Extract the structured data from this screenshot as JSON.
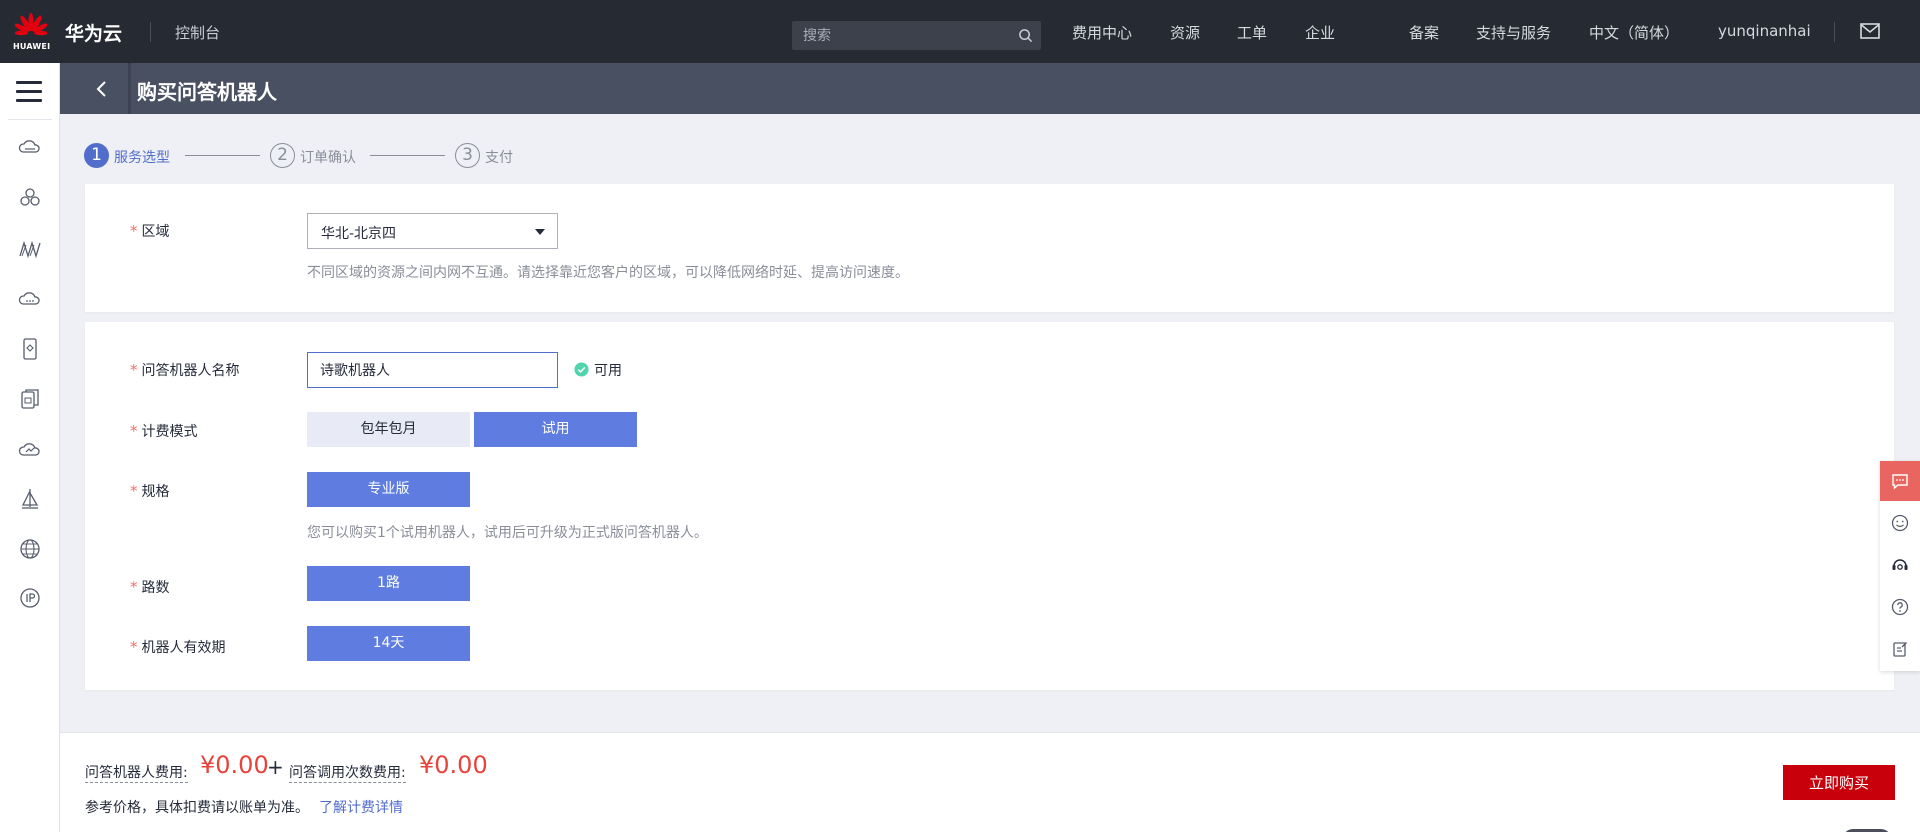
{
  "topbar": {
    "logo_text": "HUAWEI",
    "brand": "华为云",
    "console": "控制台",
    "search_placeholder": "搜索",
    "nav": {
      "billing": "费用中心",
      "resources": "资源",
      "tickets": "工单",
      "enterprise": "企业",
      "icp": "备案",
      "support": "支持与服务",
      "language": "中文（简体）",
      "user": "yunqinanhai"
    }
  },
  "header": {
    "title": "购买问答机器人"
  },
  "steps": [
    {
      "num": "1",
      "label": "服务选型",
      "active": true
    },
    {
      "num": "2",
      "label": "订单确认",
      "active": false
    },
    {
      "num": "3",
      "label": "支付",
      "active": false
    }
  ],
  "region": {
    "label": "区域",
    "value": "华北-北京四",
    "hint": "不同区域的资源之间内网不互通。请选择靠近您客户的区域，可以降低网络时延、提高访问速度。"
  },
  "form": {
    "name": {
      "label": "问答机器人名称",
      "value": "诗歌机器人",
      "status": "可用"
    },
    "billing": {
      "label": "计费模式",
      "options": [
        "包年包月",
        "试用"
      ],
      "selected": "试用"
    },
    "spec": {
      "label": "规格",
      "options": [
        "专业版"
      ],
      "selected": "专业版",
      "hint": "您可以购买1个试用机器人，试用后可升级为正式版问答机器人。"
    },
    "channels": {
      "label": "路数",
      "options": [
        "1路"
      ],
      "selected": "1路"
    },
    "validity": {
      "label": "机器人有效期",
      "options": [
        "14天"
      ],
      "selected": "14天"
    }
  },
  "footer": {
    "robot_fee_label": "问答机器人费用:",
    "robot_fee_value": "¥0.00",
    "plus": "+",
    "call_fee_label": "问答调用次数费用:",
    "call_fee_value": "¥0.00",
    "note": "参考价格，具体扣费请以账单为准。",
    "note_link": "了解计费详情",
    "buy_button": "立即购买"
  },
  "colors": {
    "topbar": "#262a33",
    "header": "#495061",
    "accent": "#526ecc",
    "option_selected": "#5f7de0",
    "buy_button": "#c7000b",
    "price": "#e8433b",
    "chat_float": "#e9655f"
  }
}
